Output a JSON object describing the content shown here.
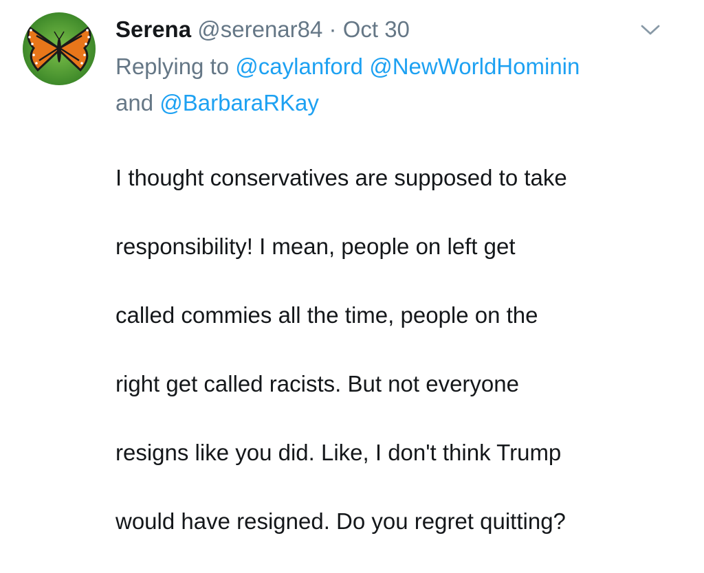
{
  "tweet": {
    "author_name": "Serena",
    "author_handle": "@serenar84",
    "separator": "·",
    "date": "Oct 30",
    "reply": {
      "prefix": "Replying to",
      "mentions": [
        "@caylanford",
        "@NewWorldHominin",
        "@BarbaraRKay"
      ],
      "conjunction": "and"
    },
    "text_lines": [
      "I thought conservatives are supposed to take",
      "responsibility! I mean, people on left get",
      "called commies all the time, people on the",
      "right get called racists. But not everyone",
      "resigns like you did. Like, I don't think Trump",
      "would have resigned. Do you regret quitting?"
    ]
  },
  "icons": {
    "avatar": "butterfly-avatar-icon",
    "menu": "chevron-down-icon"
  },
  "colors": {
    "text": "#14171a",
    "muted": "#657786",
    "link": "#1da1f2"
  }
}
